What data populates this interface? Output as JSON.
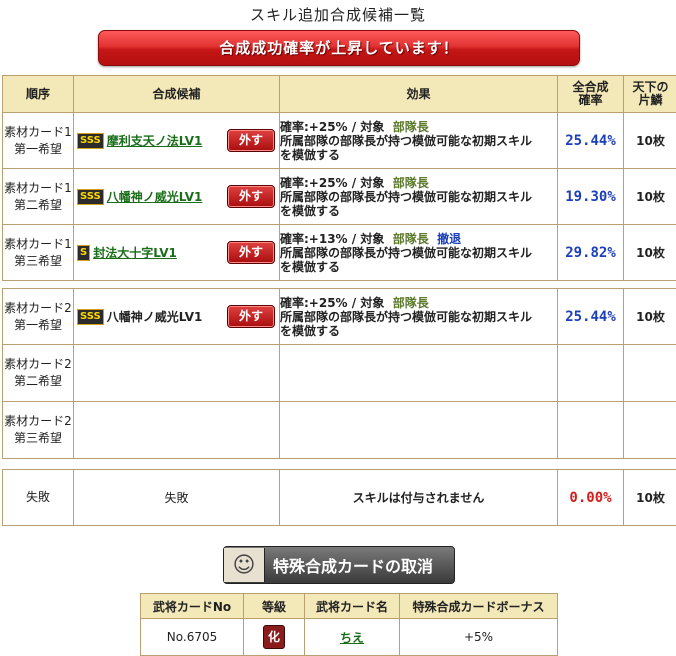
{
  "title": "スキル追加合成候補一覧",
  "banner": "合成成功確率が上昇しています！",
  "headers": {
    "order": "順序",
    "candidate": "合成候補",
    "effect": "効果",
    "rate": "全合成\n確率",
    "cost": "天下の\n片鱗"
  },
  "remove_label": "外す",
  "card1": [
    {
      "slot1": "素材カード1",
      "slot2": "第一希望",
      "badge": "SSS",
      "skill": "摩利支天ノ法LV1",
      "eff1": "確率:+25% / 対象",
      "target": "部隊長",
      "excl": "",
      "eff2": "所属部隊の部隊長が持つ模倣可能な初期スキル",
      "eff3": "を模倣する",
      "rate": "25.44%",
      "cost": "10枚"
    },
    {
      "slot1": "素材カード1",
      "slot2": "第二希望",
      "badge": "SSS",
      "skill": "八幡神ノ威光LV1",
      "eff1": "確率:+25% / 対象",
      "target": "部隊長",
      "excl": "",
      "eff2": "所属部隊の部隊長が持つ模倣可能な初期スキル",
      "eff3": "を模倣する",
      "rate": "19.30%",
      "cost": "10枚"
    },
    {
      "slot1": "素材カード1",
      "slot2": "第三希望",
      "badge": "S",
      "skill": "封法大十字LV1",
      "eff1": "確率:+13% / 対象",
      "target": "部隊長",
      "excl": "撤退",
      "eff2": "所属部隊の部隊長が持つ模倣可能な初期スキル",
      "eff3": "を模倣する",
      "rate": "29.82%",
      "cost": "10枚"
    }
  ],
  "card2": [
    {
      "slot1": "素材カード2",
      "slot2": "第一希望",
      "badge": "SSS",
      "skill": "八幡神ノ威光LV1",
      "eff1": "確率:+25% / 対象",
      "target": "部隊長",
      "eff2": "所属部隊の部隊長が持つ模倣可能な初期スキル",
      "eff3": "を模倣する",
      "rate": "25.44%",
      "cost": "10枚"
    },
    {
      "slot1": "素材カード2",
      "slot2": "第二希望"
    },
    {
      "slot1": "素材カード2",
      "slot2": "第三希望"
    }
  ],
  "fail": {
    "order": "失敗",
    "candidate": "失敗",
    "effect": "スキルは付与されません",
    "rate": "0.00%",
    "cost": "10枚"
  },
  "cancel_button": "特殊合成カードの取消",
  "special": {
    "headers": [
      "武将カードNo",
      "等級",
      "武将カード名",
      "特殊合成カードボーナス"
    ],
    "row": {
      "no": "No.6705",
      "rank": "化",
      "name": "ちえ",
      "bonus": "+5%"
    }
  }
}
